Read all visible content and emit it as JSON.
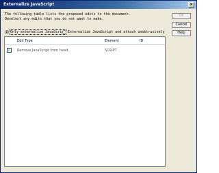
{
  "window": {
    "title": "Externalize JavaScript",
    "close_glyph": "×"
  },
  "description": {
    "line1": "The following table lists the proposed edits to the document.",
    "line2": "Deselect any edits that you do not want to make."
  },
  "options": {
    "only_externalize": "Only externalize JavaScript",
    "externalize_unobtrusively": "Externalize JavaScript and attach unobtrusively",
    "selected": "only_externalize"
  },
  "table": {
    "columns": [
      "Edit Type",
      "Element",
      "ID"
    ],
    "rows": [
      {
        "checked": true,
        "edit_type": "Remove JavaScript from head",
        "element": "SCRIPT",
        "id": ""
      }
    ]
  },
  "buttons": {
    "ok": "OK",
    "cancel": "Cancel",
    "help": "Help"
  },
  "colors": {
    "titlebar": "#0a246a",
    "dialog_bg": "#ece9d8"
  }
}
